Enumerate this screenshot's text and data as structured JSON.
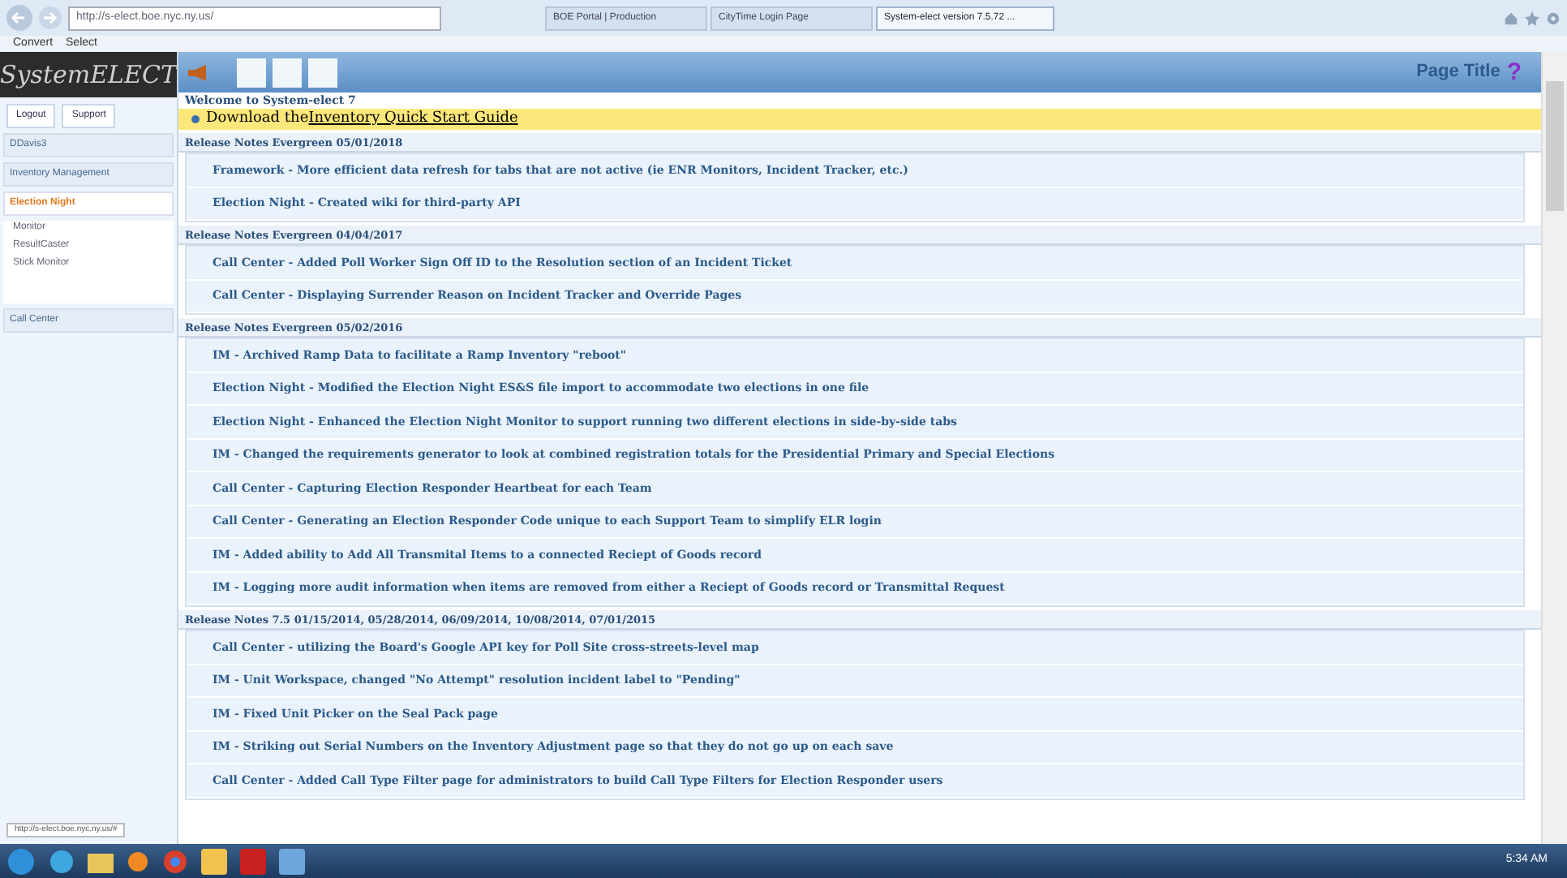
{
  "browser": {
    "address": "http://s-elect.boe.nyc.ny.us/",
    "tabs": [
      {
        "label": "BOE Portal | Production",
        "selected": false
      },
      {
        "label": "CityTime Login Page",
        "selected": false
      },
      {
        "label": "System-elect version 7.5.72 ...",
        "selected": true
      }
    ],
    "favorites": [
      "Convert",
      "Select"
    ],
    "status_url": "http://s-elect.boe.nyc.ny.us/#"
  },
  "sidebar": {
    "logo": "SystemELECT",
    "links": [
      "Logout",
      "Support"
    ],
    "items": [
      {
        "label": "DDavis3",
        "expanded": false
      },
      {
        "label": "Inventory Management",
        "expanded": false
      },
      {
        "label": "Election Night",
        "expanded": true,
        "children": [
          {
            "label": "Monitor"
          },
          {
            "label": "ResultCaster"
          },
          {
            "label": "Stick Monitor"
          }
        ]
      },
      {
        "label": "Call Center",
        "expanded": false
      }
    ]
  },
  "header": {
    "title": "Page Title",
    "help": "?"
  },
  "welcome": "Welcome to System-elect 7",
  "notice": {
    "text": "Download the ",
    "link": "Inventory Quick Start Guide"
  },
  "sections": [
    {
      "title": "Release Notes Evergreen 05/01/2018",
      "items": [
        "Framework - More efficient data refresh for tabs that are not active (ie ENR Monitors, Incident Tracker, etc.)",
        "Election Night - Created wiki for third-party API"
      ]
    },
    {
      "title": "Release Notes Evergreen 04/04/2017",
      "items": [
        "Call Center - Added Poll Worker Sign Off ID to the Resolution section of an Incident Ticket",
        "Call Center - Displaying Surrender Reason on Incident Tracker and Override Pages"
      ]
    },
    {
      "title": "Release Notes Evergreen 05/02/2016",
      "items": [
        "IM - Archived Ramp Data to facilitate a Ramp Inventory \"reboot\"",
        "Election Night - Modified the Election Night ES&S file import to accommodate two elections in one file",
        "Election Night - Enhanced the Election Night Monitor to support running two different elections in side-by-side tabs",
        "IM - Changed the requirements generator to look at combined registration totals for the Presidential Primary and Special Elections",
        "Call Center - Capturing Election Responder Heartbeat for each Team",
        "Call Center - Generating an Election Responder Code unique to each Support Team to simplify ELR login",
        "IM - Added ability to Add All Transmital Items to a connected Reciept of Goods record",
        "IM - Logging more audit information when items are removed from either a Reciept of Goods record or Transmittal Request"
      ]
    },
    {
      "title": "Release Notes 7.5 01/15/2014, 05/28/2014, 06/09/2014, 10/08/2014, 07/01/2015",
      "items": [
        "Call Center - utilizing the Board's Google API key for Poll Site cross-streets-level map",
        "IM - Unit Workspace, changed \"No Attempt\" resolution incident label to \"Pending\"",
        "IM - Fixed Unit Picker on the Seal Pack page",
        "IM - Striking out Serial Numbers on the Inventory Adjustment page so that they do not go up on each save",
        "Call Center - Added Call Type Filter page for administrators to build Call Type Filters for Election Responder users"
      ]
    }
  ],
  "taskbar": {
    "clock": "5:34 AM"
  }
}
